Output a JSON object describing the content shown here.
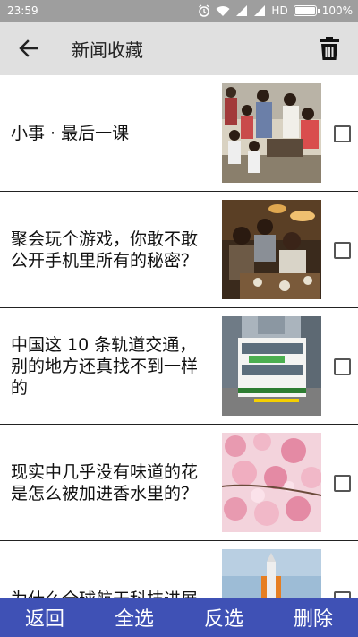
{
  "status_bar": {
    "time": "23:59",
    "network": "HD",
    "battery": "100%",
    "battery_level": 1.0,
    "icons": [
      "alarm-icon",
      "wifi-icon",
      "signal-icon",
      "signal-icon"
    ]
  },
  "toolbar": {
    "title": "新闻收藏",
    "back_icon": "back-arrow-icon",
    "delete_icon": "trash-icon",
    "background": "#e0e0e0"
  },
  "news_items": [
    {
      "title": "小事 · 最后一课",
      "image": "classroom-photo",
      "checked": false
    },
    {
      "title": "聚会玩个游戏，你敢不敢公开手机里所有的秘密？",
      "image": "party-photo",
      "checked": false
    },
    {
      "title": "中国这 10 条轨道交通，别的地方还真找不到一样的",
      "image": "tram-photo",
      "checked": false
    },
    {
      "title": "现实中几乎没有味道的花是怎么被加进香水里的？",
      "image": "blossom-photo",
      "checked": false
    },
    {
      "title": "为什么全球航天科技进展",
      "image": "rocket-photo",
      "checked": false
    }
  ],
  "bottom_bar": {
    "back_label": "返回",
    "select_all_label": "全选",
    "invert_label": "反选",
    "delete_label": "删除",
    "background": "#3f51b5"
  }
}
